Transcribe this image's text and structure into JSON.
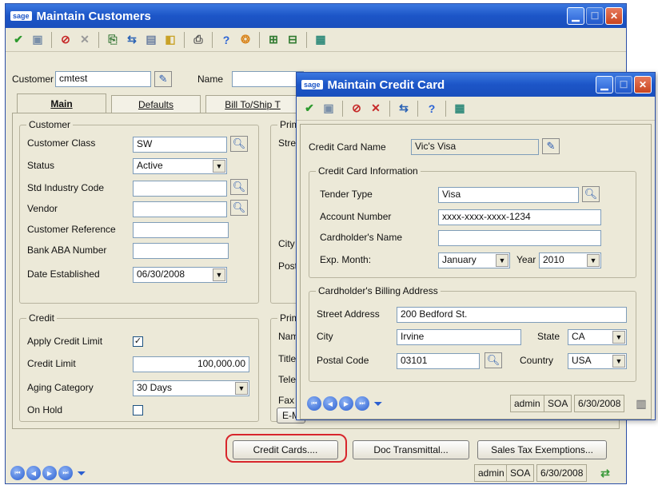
{
  "customers_window": {
    "title": "Maintain Customers",
    "customer_label": "Customer",
    "customer_value": "cmtest",
    "name_label": "Name",
    "tabs": [
      "Main",
      "Defaults",
      "Bill To/Ship T"
    ],
    "customer_group": "Customer",
    "fields": {
      "customer_class_label": "Customer Class",
      "customer_class": "SW",
      "status_label": "Status",
      "status": "Active",
      "std_industry_label": "Std Industry Code",
      "vendor_label": "Vendor",
      "customer_reference_label": "Customer Reference",
      "bank_aba_label": "Bank ABA Number",
      "date_established_label": "Date Established",
      "date_established": "06/30/2008"
    },
    "primary_labels": [
      "Prim",
      "Stre",
      "City",
      "Post",
      "Prim",
      "Nam",
      "Title",
      "Telep",
      "Fax",
      "E-M"
    ],
    "credit_group": "Credit",
    "credit": {
      "apply_label": "Apply Credit Limit",
      "apply_checked": "✓",
      "limit_label": "Credit Limit",
      "limit_value": "100,000.00",
      "aging_label": "Aging Category",
      "aging_value": "30 Days",
      "on_hold_label": "On Hold"
    },
    "buttons": {
      "credit_cards": "Credit Cards....",
      "doc_transmittal": "Doc Transmittal...",
      "sales_tax": "Sales Tax Exemptions..."
    },
    "status_bar": {
      "user": "admin",
      "company": "SOA",
      "date": "6/30/2008"
    }
  },
  "credit_card_window": {
    "title": "Maintain Credit Card",
    "card_name_label": "Credit Card Name",
    "card_name": "Vic's Visa",
    "info_group": "Credit Card Information",
    "tender_type_label": "Tender Type",
    "tender_type": "Visa",
    "account_number_label": "Account Number",
    "account_number": "xxxx-xxxx-xxxx-1234",
    "cardholder_name_label": "Cardholder's Name",
    "cardholder_name": "",
    "exp_month_label": "Exp. Month:",
    "exp_month": "January",
    "year_label": "Year",
    "year": "2010",
    "billing_group": "Cardholder's Billing Address",
    "street_label": "Street Address",
    "street": "200 Bedford St.",
    "city_label": "City",
    "city": "Irvine",
    "state_label": "State",
    "state": "CA",
    "postal_label": "Postal Code",
    "postal": "03101",
    "country_label": "Country",
    "country": "USA",
    "status_bar": {
      "user": "admin",
      "company": "SOA",
      "date": "6/30/2008"
    }
  },
  "sage_logo": "sage",
  "colors": {
    "title_blue": "#1c55c7",
    "highlight_red": "#d8262c",
    "window_bg": "#ece9d8"
  }
}
